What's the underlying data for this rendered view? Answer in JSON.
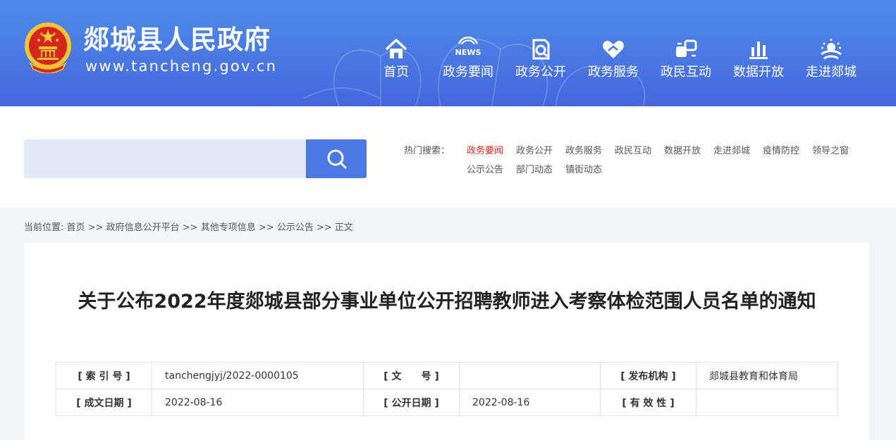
{
  "header": {
    "site_name": "郯城县人民政府",
    "site_url": "www.tancheng.gov.cn",
    "emblem_icon": "national-emblem-icon",
    "nav": [
      {
        "label": "首页",
        "icon": "home-icon"
      },
      {
        "label": "政务要闻",
        "icon": "news-icon",
        "icon_text": "NEWS"
      },
      {
        "label": "政务公开",
        "icon": "open-document-icon"
      },
      {
        "label": "政务服务",
        "icon": "heart-service-icon"
      },
      {
        "label": "政民互动",
        "icon": "interaction-icon"
      },
      {
        "label": "数据开放",
        "icon": "bar-chart-icon"
      },
      {
        "label": "走进郯城",
        "icon": "sunrise-icon"
      }
    ]
  },
  "search": {
    "placeholder": "",
    "button_icon": "search-icon",
    "hot_label": "热门搜索：",
    "hot_links": [
      "政务要闻",
      "政务公开",
      "政务服务",
      "政民互动",
      "数据开放",
      "走进郯城",
      "疫情防控",
      "领导之窗",
      "公示公告",
      "部门动态",
      "镇街动态"
    ],
    "active_link_color": "#d9261c"
  },
  "breadcrumb": {
    "prefix": "当前位置:",
    "items": [
      "首页",
      "政府信息公开平台",
      "其他专项信息",
      "公示公告",
      "正文"
    ],
    "separator": ">>"
  },
  "article": {
    "title": "关于公布2022年度郯城县部分事业单位公开招聘教师进入考察体检范围人员名单的通知",
    "meta": {
      "index_label": "[ 索 引 号 ]",
      "index_value": "tanchengjyj/2022-0000105",
      "doc_no_label": "[ 文　　号 ]",
      "doc_no_value": "",
      "publisher_label": "[ 发布机构 ]",
      "publisher_value": "郯城县教育和体育局",
      "written_date_label": "[ 成文日期 ]",
      "written_date_value": "2022-08-16",
      "public_date_label": "[ 公开日期 ]",
      "public_date_value": "2022-08-16",
      "validity_label": "[ 有 效 性 ]",
      "validity_value": ""
    }
  },
  "colors": {
    "header_blue": "#4a78e2",
    "search_button": "#4b78e3",
    "search_field": "#e2eaf6",
    "page_bg": "#f1f4f8"
  }
}
